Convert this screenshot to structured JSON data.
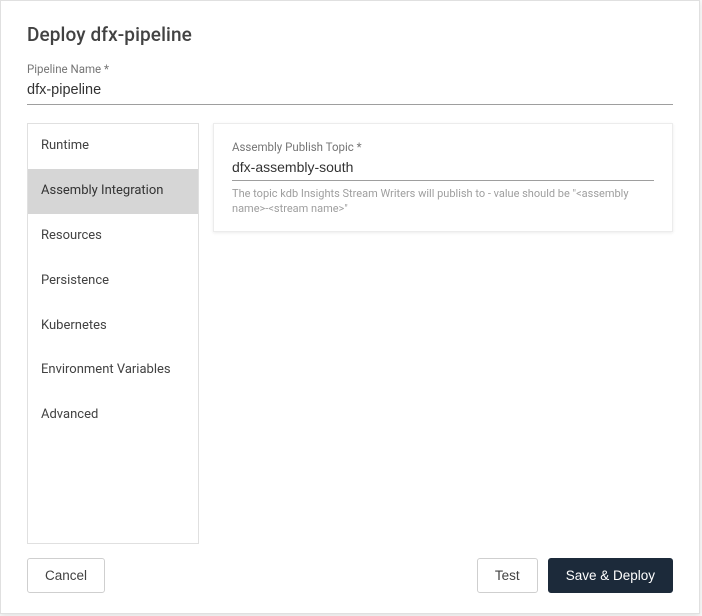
{
  "dialog": {
    "title": "Deploy dfx-pipeline"
  },
  "pipelineName": {
    "label": "Pipeline Name *",
    "value": "dfx-pipeline"
  },
  "tabs": [
    {
      "label": "Runtime"
    },
    {
      "label": "Assembly Integration"
    },
    {
      "label": "Resources"
    },
    {
      "label": "Persistence"
    },
    {
      "label": "Kubernetes"
    },
    {
      "label": "Environment Variables"
    },
    {
      "label": "Advanced"
    }
  ],
  "activeTabIndex": 1,
  "assemblyPublishTopic": {
    "label": "Assembly Publish Topic *",
    "value": "dfx-assembly-south",
    "help": "The topic kdb Insights Stream Writers will publish to - value should be \"<assembly name>-<stream name>\""
  },
  "buttons": {
    "cancel": "Cancel",
    "test": "Test",
    "saveDeploy": "Save & Deploy"
  }
}
